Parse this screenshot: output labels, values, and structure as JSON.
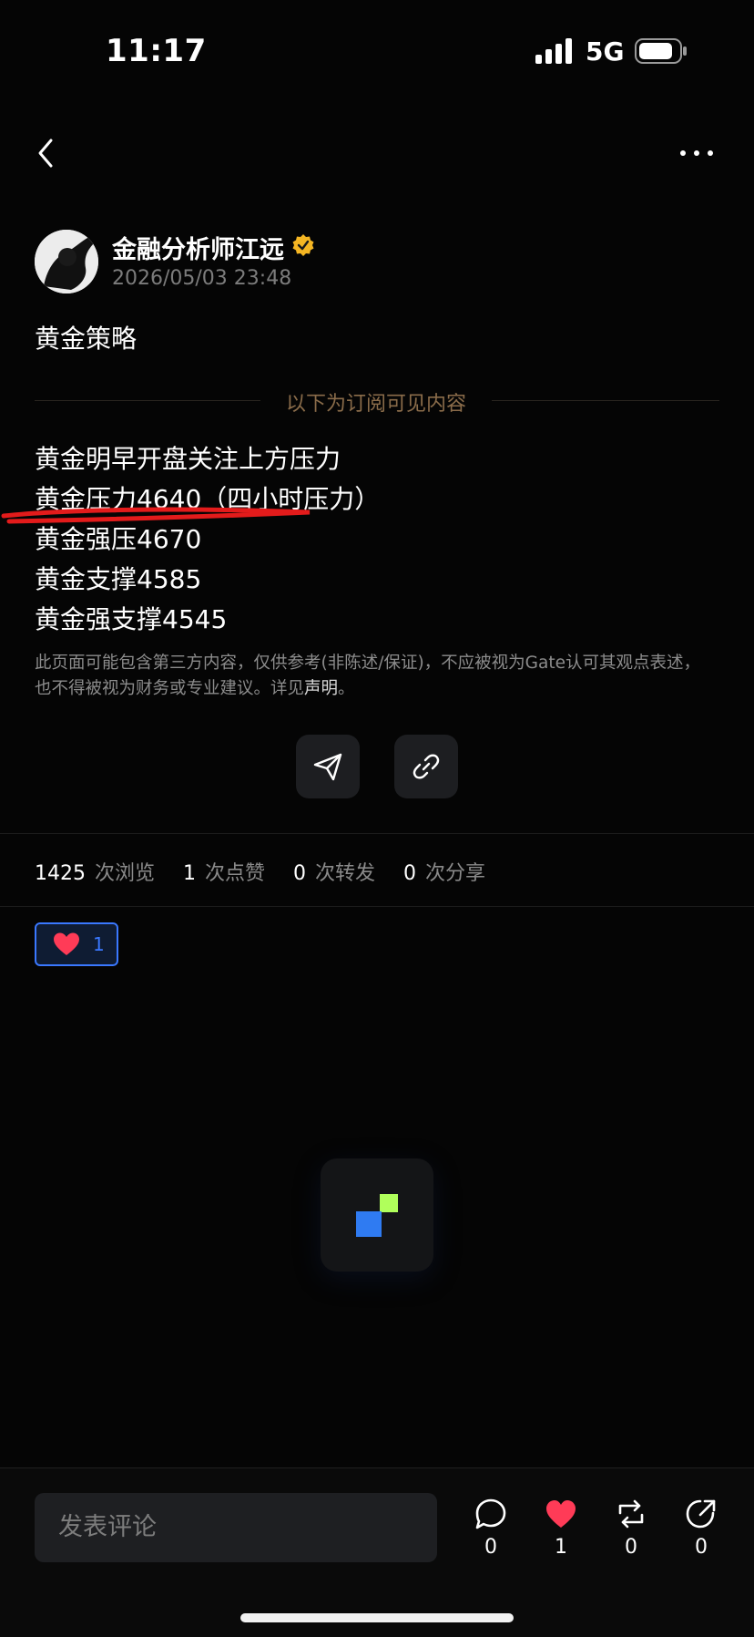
{
  "status_bar": {
    "time": "11:17",
    "network": "5G"
  },
  "author": {
    "name": "金融分析师江远",
    "date": "2026/05/03 23:48"
  },
  "post": {
    "title": "黄金策略",
    "subscriber_divider": "以下为订阅可见内容",
    "lines": [
      "黄金明早开盘关注上方压力",
      "黄金压力4640（四小时压力）",
      "黄金强压4670",
      "黄金支撑4585",
      "黄金强支撑4545"
    ],
    "disclaimer_text": "此页面可能包含第三方内容，仅供参考(非陈述/保证)，不应被视为Gate认可其观点表述，也不得被视为财务或专业建议。详见",
    "disclaimer_link": "声明",
    "disclaimer_end": "。"
  },
  "stats": {
    "views": "1425",
    "views_label": "次浏览",
    "likes": "1",
    "likes_label": "次点赞",
    "reposts": "0",
    "reposts_label": "次转发",
    "shares": "0",
    "shares_label": "次分享"
  },
  "reaction": {
    "count": "1"
  },
  "bottom": {
    "comment_placeholder": "发表评论",
    "comment_count": "0",
    "like_count": "1",
    "repost_count": "0",
    "share_count": "0"
  },
  "colors": {
    "accent_blue": "#3a78ff",
    "like_red": "#ff3b57",
    "verified_gold": "#f5b623"
  }
}
